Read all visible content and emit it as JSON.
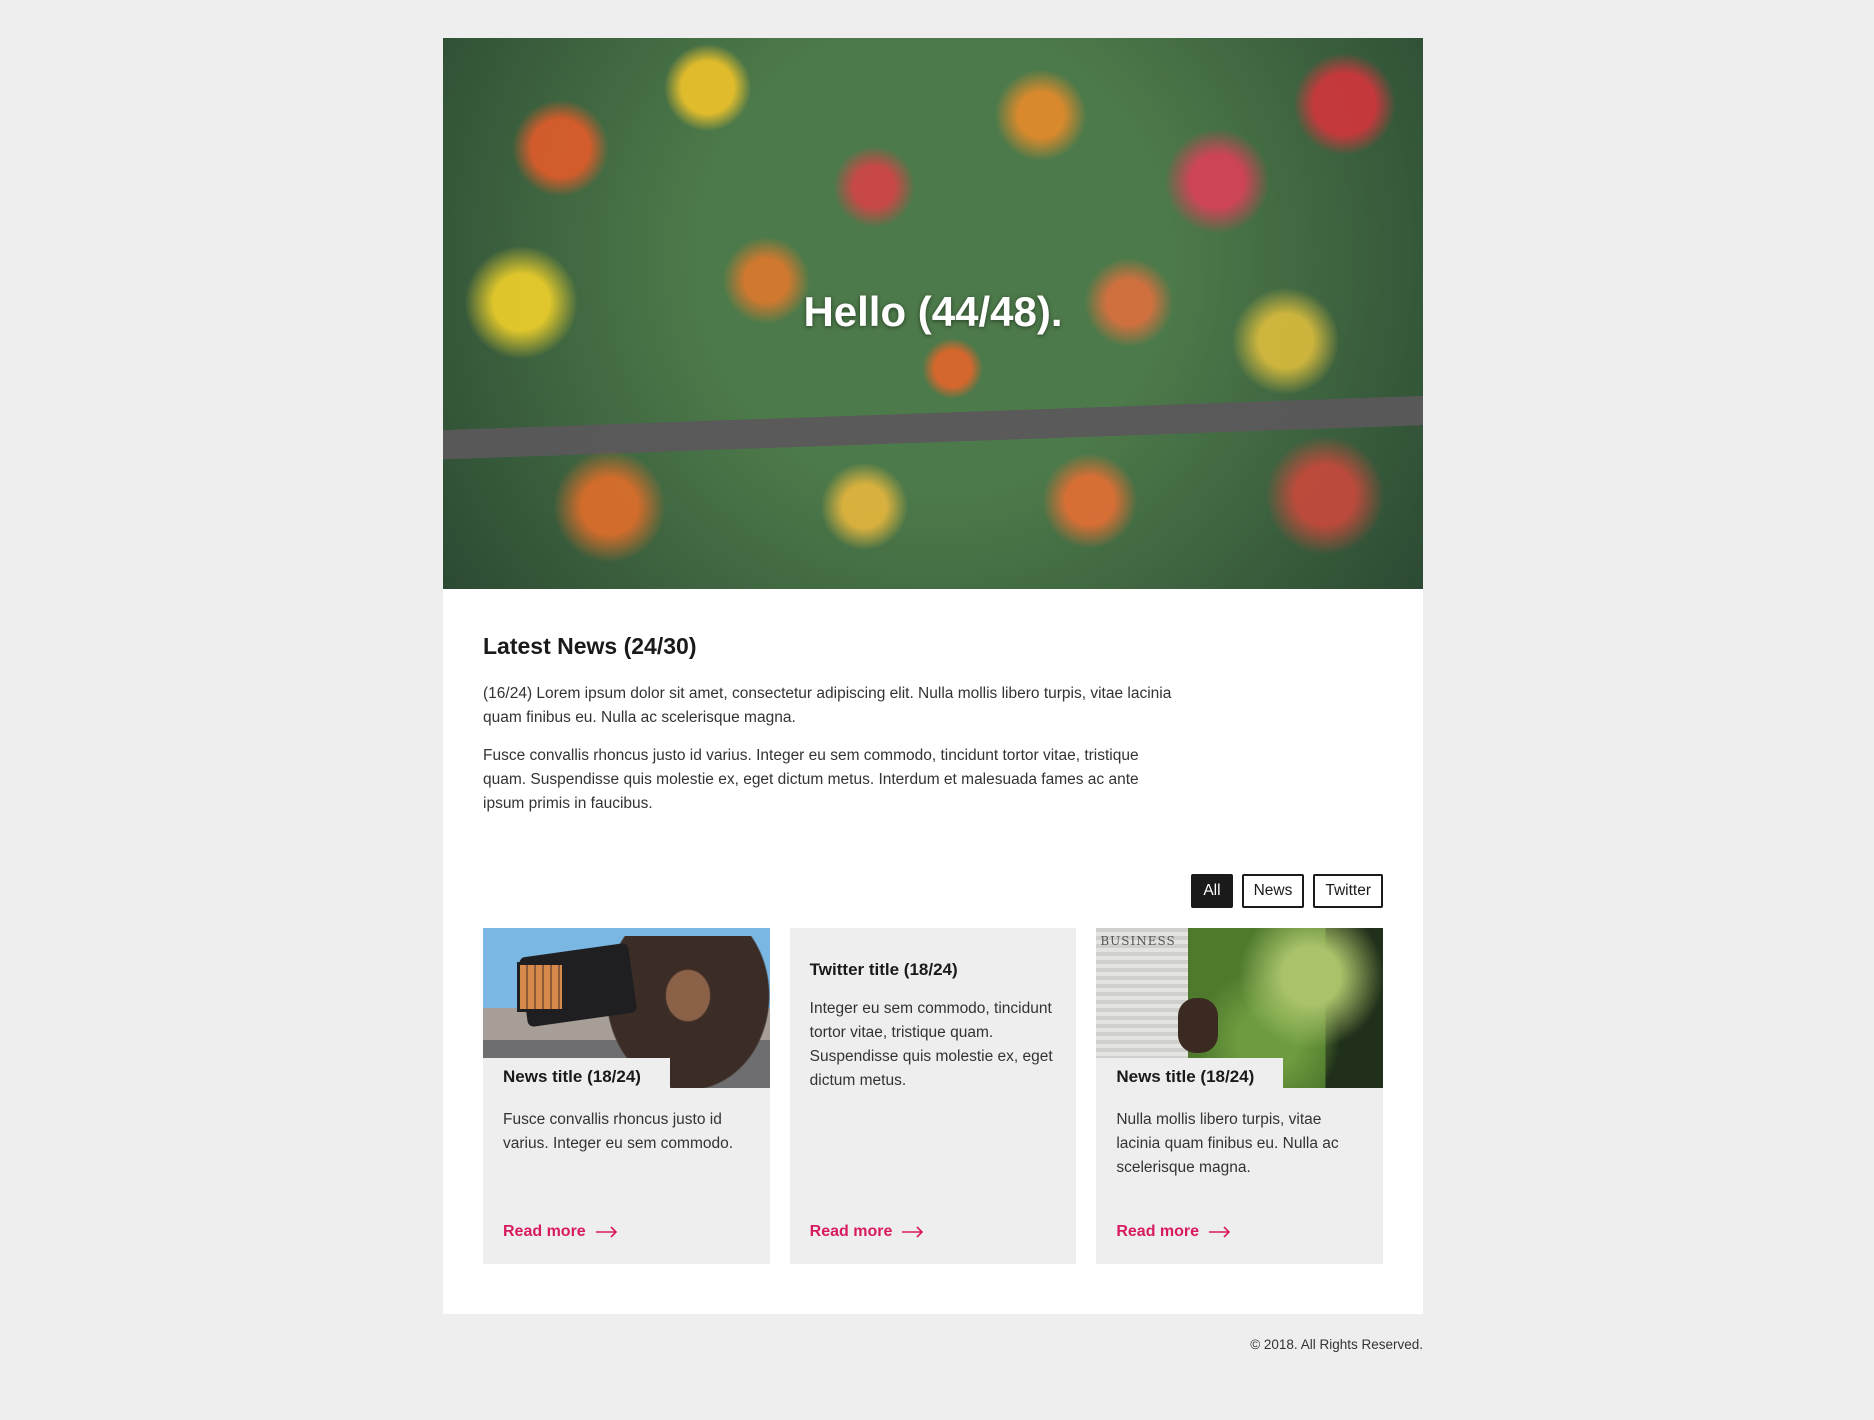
{
  "hero": {
    "title": "Hello (44/48)."
  },
  "news": {
    "title": "Latest News (24/30)",
    "paragraphs": [
      "(16/24) Lorem ipsum dolor sit amet, consectetur adipiscing elit. Nulla mollis libero turpis, vitae lacinia quam finibus eu. Nulla ac scelerisque magna.",
      "Fusce convallis rhoncus justo id varius. Integer eu sem commodo, tincidunt tortor vitae, tristique quam. Suspendisse quis molestie ex, eget dictum metus. Interdum et malesuada fames ac ante ipsum primis in faucibus."
    ]
  },
  "filters": [
    {
      "label": "All",
      "active": true
    },
    {
      "label": "News",
      "active": false
    },
    {
      "label": "Twitter",
      "active": false
    }
  ],
  "cards": [
    {
      "type": "news",
      "title": "News title (18/24)",
      "text": "Fusce convallis rhoncus justo id varius. Integer eu sem commodo.",
      "link": "Read more"
    },
    {
      "type": "twitter",
      "title": "Twitter title (18/24)",
      "text": "Integer eu sem commodo, tincidunt tortor vitae, tristique quam. Suspendisse quis molestie ex, eget dictum metus.",
      "link": "Read more"
    },
    {
      "type": "news",
      "title": "News title (18/24)",
      "text": "Nulla mollis libero turpis, vitae lacinia quam finibus eu. Nulla ac scelerisque magna.",
      "link": "Read more",
      "image_text": "BUSINESS"
    }
  ],
  "footer": {
    "text": "© 2018. All Rights Reserved."
  },
  "colors": {
    "accent": "#d81b60",
    "dark": "#1a1a1a",
    "background": "#eeeeee"
  }
}
